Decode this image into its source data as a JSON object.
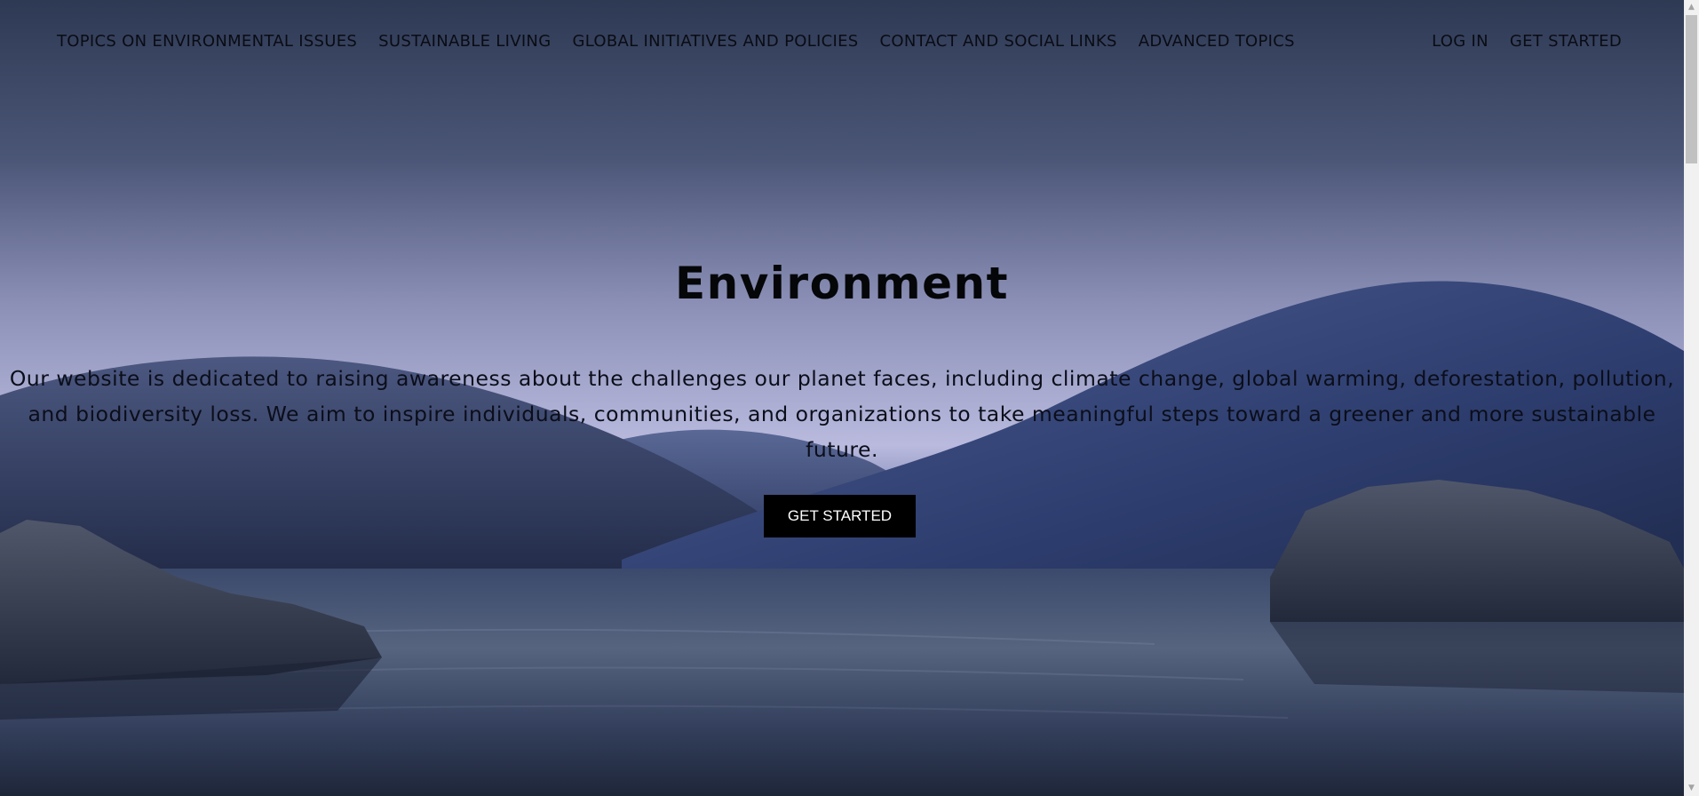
{
  "nav": {
    "items": [
      {
        "label": "TOPICS ON ENVIRONMENTAL ISSUES"
      },
      {
        "label": "SUSTAINABLE LIVING"
      },
      {
        "label": "GLOBAL INITIATIVES AND POLICIES"
      },
      {
        "label": "CONTACT AND SOCIAL LINKS"
      },
      {
        "label": "ADVANCED TOPICS"
      }
    ],
    "login_label": "LOG IN",
    "get_started_label": "GET STARTED"
  },
  "hero": {
    "title": "Environment",
    "description": "Our website is dedicated to raising awareness about the challenges our planet faces, including climate change, global warming, deforestation, pollution, and biodiversity loss. We aim to inspire individuals, communities, and organizations to take meaningful steps toward a greener and more sustainable future.",
    "cta_label": "GET STARTED"
  },
  "colors": {
    "sky_top": "#2f3b55",
    "sky_bottom": "#b8b9dc",
    "hills": "#2e3c66",
    "water": "#2a354f",
    "button_bg": "#000000",
    "button_text": "#ffffff"
  },
  "icons": {
    "scroll_up": "triangle-up-icon",
    "scroll_down": "triangle-down-icon"
  }
}
